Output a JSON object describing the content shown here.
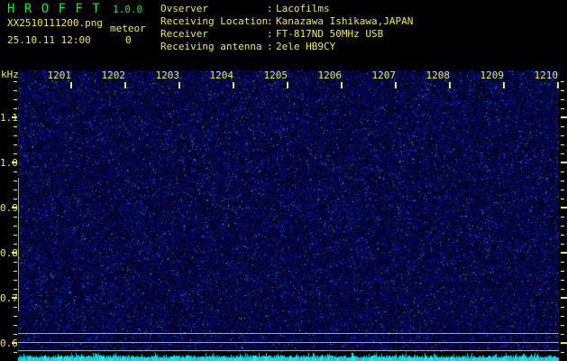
{
  "app": {
    "title": "H R O F F T",
    "version": "1.0.0"
  },
  "status": {
    "filename": "XX2510111200.png",
    "datetime": "25.10.11 12:00",
    "meteor_label": "meteor",
    "meteor_count": "0"
  },
  "info": {
    "colon": ":",
    "rows": [
      {
        "label": "Ovserver",
        "value": "Lacofilms"
      },
      {
        "label": "Receiving Location",
        "value": "Kanazawa Ishikawa,JAPAN"
      },
      {
        "label": "Receiver",
        "value": "FT-817ND 50MHz USB"
      },
      {
        "label": "Receiving antenna",
        "value": "2ele HB9CY"
      }
    ]
  },
  "chart_data": {
    "type": "heatmap",
    "title": "HROFFT 1.0.0 radio meteor echo spectrogram, 10-minute window 12:01-12:10 on 25.10.11",
    "ylabel": "kHz",
    "y_axis_unit": "kHz",
    "y_ticks_khz": [
      "1.1",
      "1.0",
      "0.9",
      "0.8",
      "0.7",
      "0.6"
    ],
    "y_minor_step_khz": 0.02,
    "x_ticks_hhmm": [
      "1201",
      "1202",
      "1203",
      "1204",
      "1205",
      "1206",
      "1207",
      "1208",
      "1209",
      "1210"
    ],
    "x_minutes_per_division": 1,
    "reference_lines_khz": [
      0.62,
      0.6,
      0.58
    ],
    "values_summary": "Uniform dark-blue background noise over the whole time/frequency plane; no meteor echo traces visible; meteor count for the interval is 0.",
    "noise_meter": "cyan audio noise-level strip along the bottom edge (12:01-12:10)"
  },
  "colors": {
    "background": "#000000",
    "green_text": "#1dea1d",
    "yellow_text": "#efef3f",
    "grid_line": "#a4a4a4",
    "vertical_line": "#8fa0b4",
    "spec_base": "#000010",
    "meter_cyan": "#00e2e2"
  }
}
